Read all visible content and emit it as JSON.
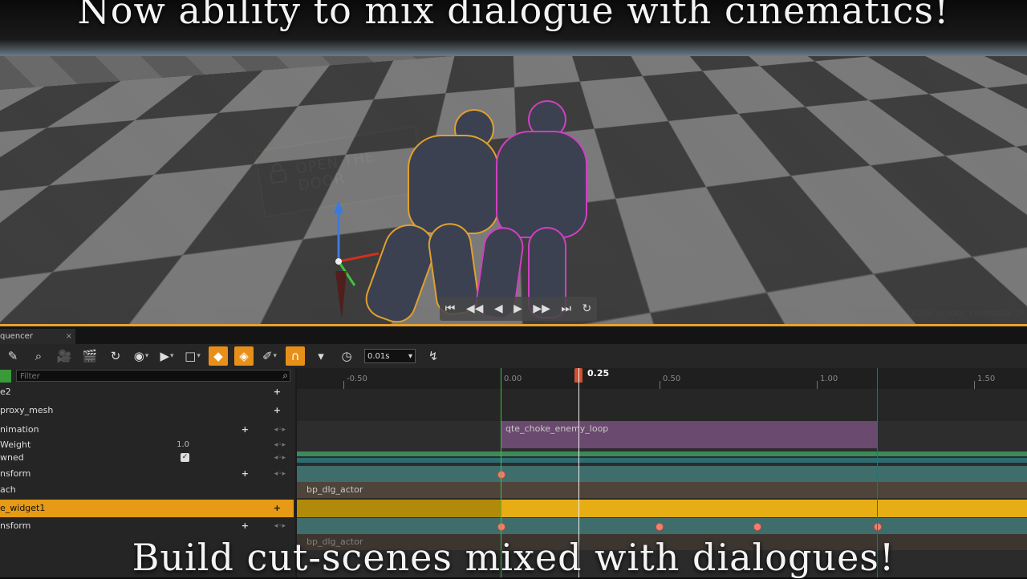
{
  "viewport": {
    "headline": "Now ability to mix dialogue with cinematics!",
    "world_label": "OPEN THE DOOR",
    "play_controls": [
      "⏮",
      "◀◀",
      "◀",
      "▶",
      "▶▶",
      "⏭",
      "↻"
    ],
    "level_prefix": "Level:",
    "level_name": "empty_cinematic (P"
  },
  "sequencer": {
    "tab_label": "quencer",
    "snap_value": "0.01s",
    "filter_placeholder": "Filter",
    "tracks": [
      {
        "name": "e2",
        "control": "plus"
      },
      {
        "name": "proxy_mesh",
        "control": "plus"
      },
      {
        "name": "nimation",
        "control": "plus"
      },
      {
        "name": "Weight",
        "value": "1.0"
      },
      {
        "name": "wned",
        "checked": true
      },
      {
        "name": "nsform",
        "control": "plus"
      },
      {
        "name": "ach"
      },
      {
        "name": "e_widget1",
        "control": "plus",
        "selected": true
      },
      {
        "name": "nsform",
        "control": "plus"
      }
    ],
    "ruler": {
      "current": "0.25",
      "ticks": [
        "-0.50",
        "0.00",
        "0.50",
        "1.00",
        "1.50"
      ]
    },
    "sections": {
      "animation_clip": "qte_choke_enemy_loop",
      "attach_actor": "bp_dlg_actor",
      "attach_actor_2": "bp_dlg_actor"
    }
  },
  "footer": {
    "caption": "Build cut-scenes mixed with dialogues!"
  },
  "colors": {
    "accent": "#e69a15",
    "playhead": "#d05030",
    "anim_section": "#6a4a6e",
    "transform_lane": "#3f6d6b"
  }
}
